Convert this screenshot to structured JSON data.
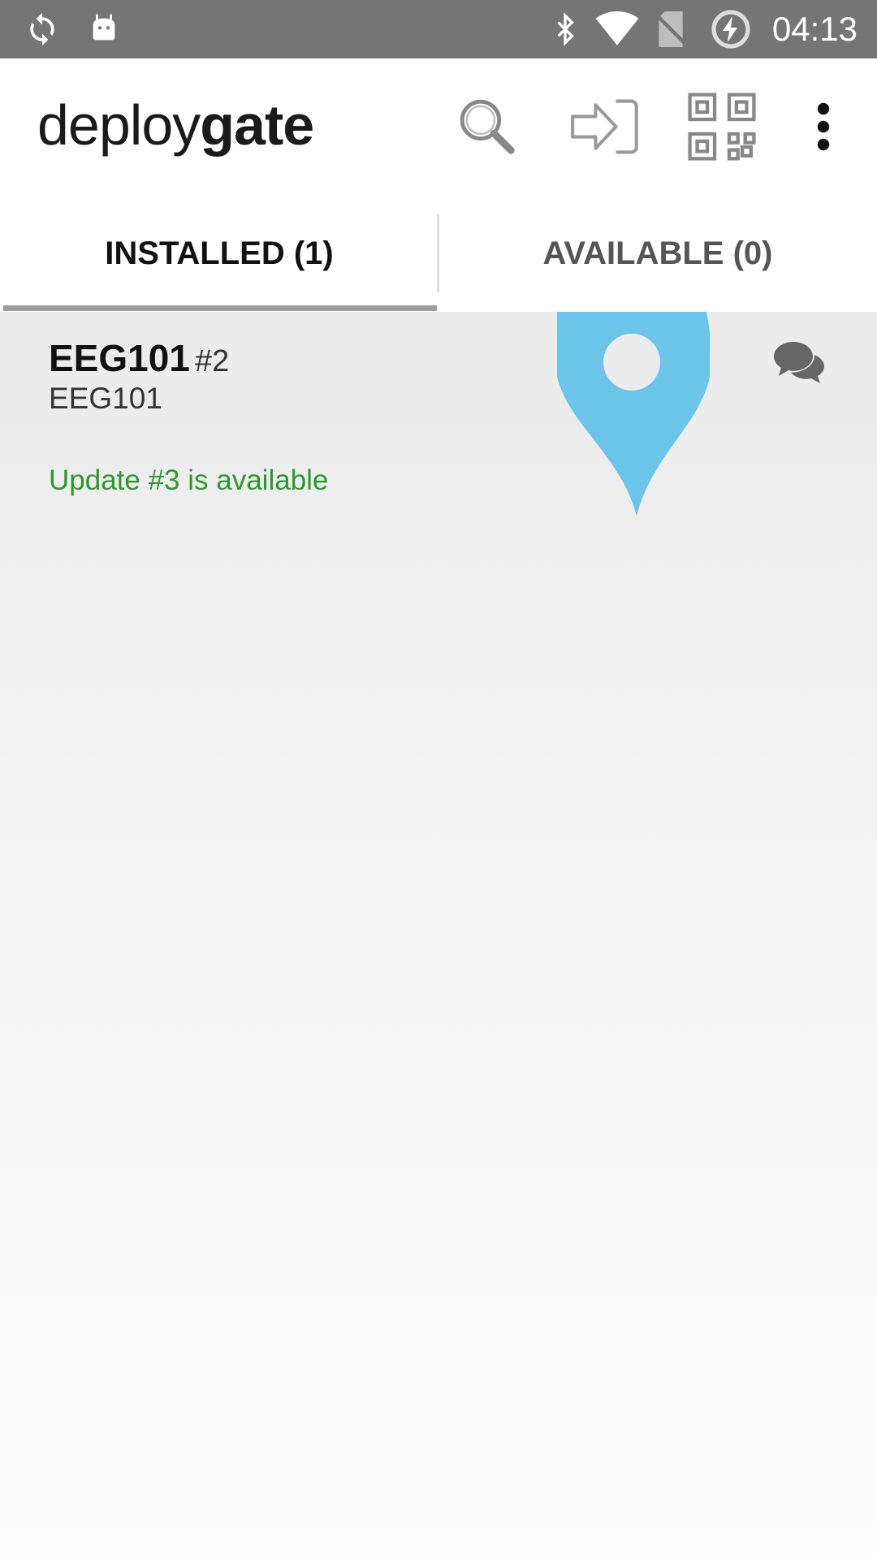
{
  "status_bar": {
    "time": "04:13",
    "icons": [
      "sync-icon",
      "android-icon",
      "bluetooth-icon",
      "wifi-icon",
      "no-sim-icon",
      "battery-charging-icon"
    ]
  },
  "app_bar": {
    "logo_part1": "deploy",
    "logo_part2": "gate",
    "actions": [
      "search-icon",
      "sign-in-icon",
      "qr-code-icon",
      "more-vert-icon"
    ]
  },
  "tabs": [
    {
      "label": "INSTALLED (1)",
      "selected": true
    },
    {
      "label": "AVAILABLE (0)",
      "selected": false
    }
  ],
  "apps": [
    {
      "name": "EEG101",
      "revision": "#2",
      "package": "EEG101",
      "update_text": "Update #3 is available",
      "marker_icon": "location-pin-icon",
      "comment_icon": "comment-icon"
    }
  ],
  "colors": {
    "status_bar": "#757575",
    "update_text": "#2a9a2a",
    "pin": "#6ac5e8",
    "tab_indicator": "#9e9e9e"
  }
}
